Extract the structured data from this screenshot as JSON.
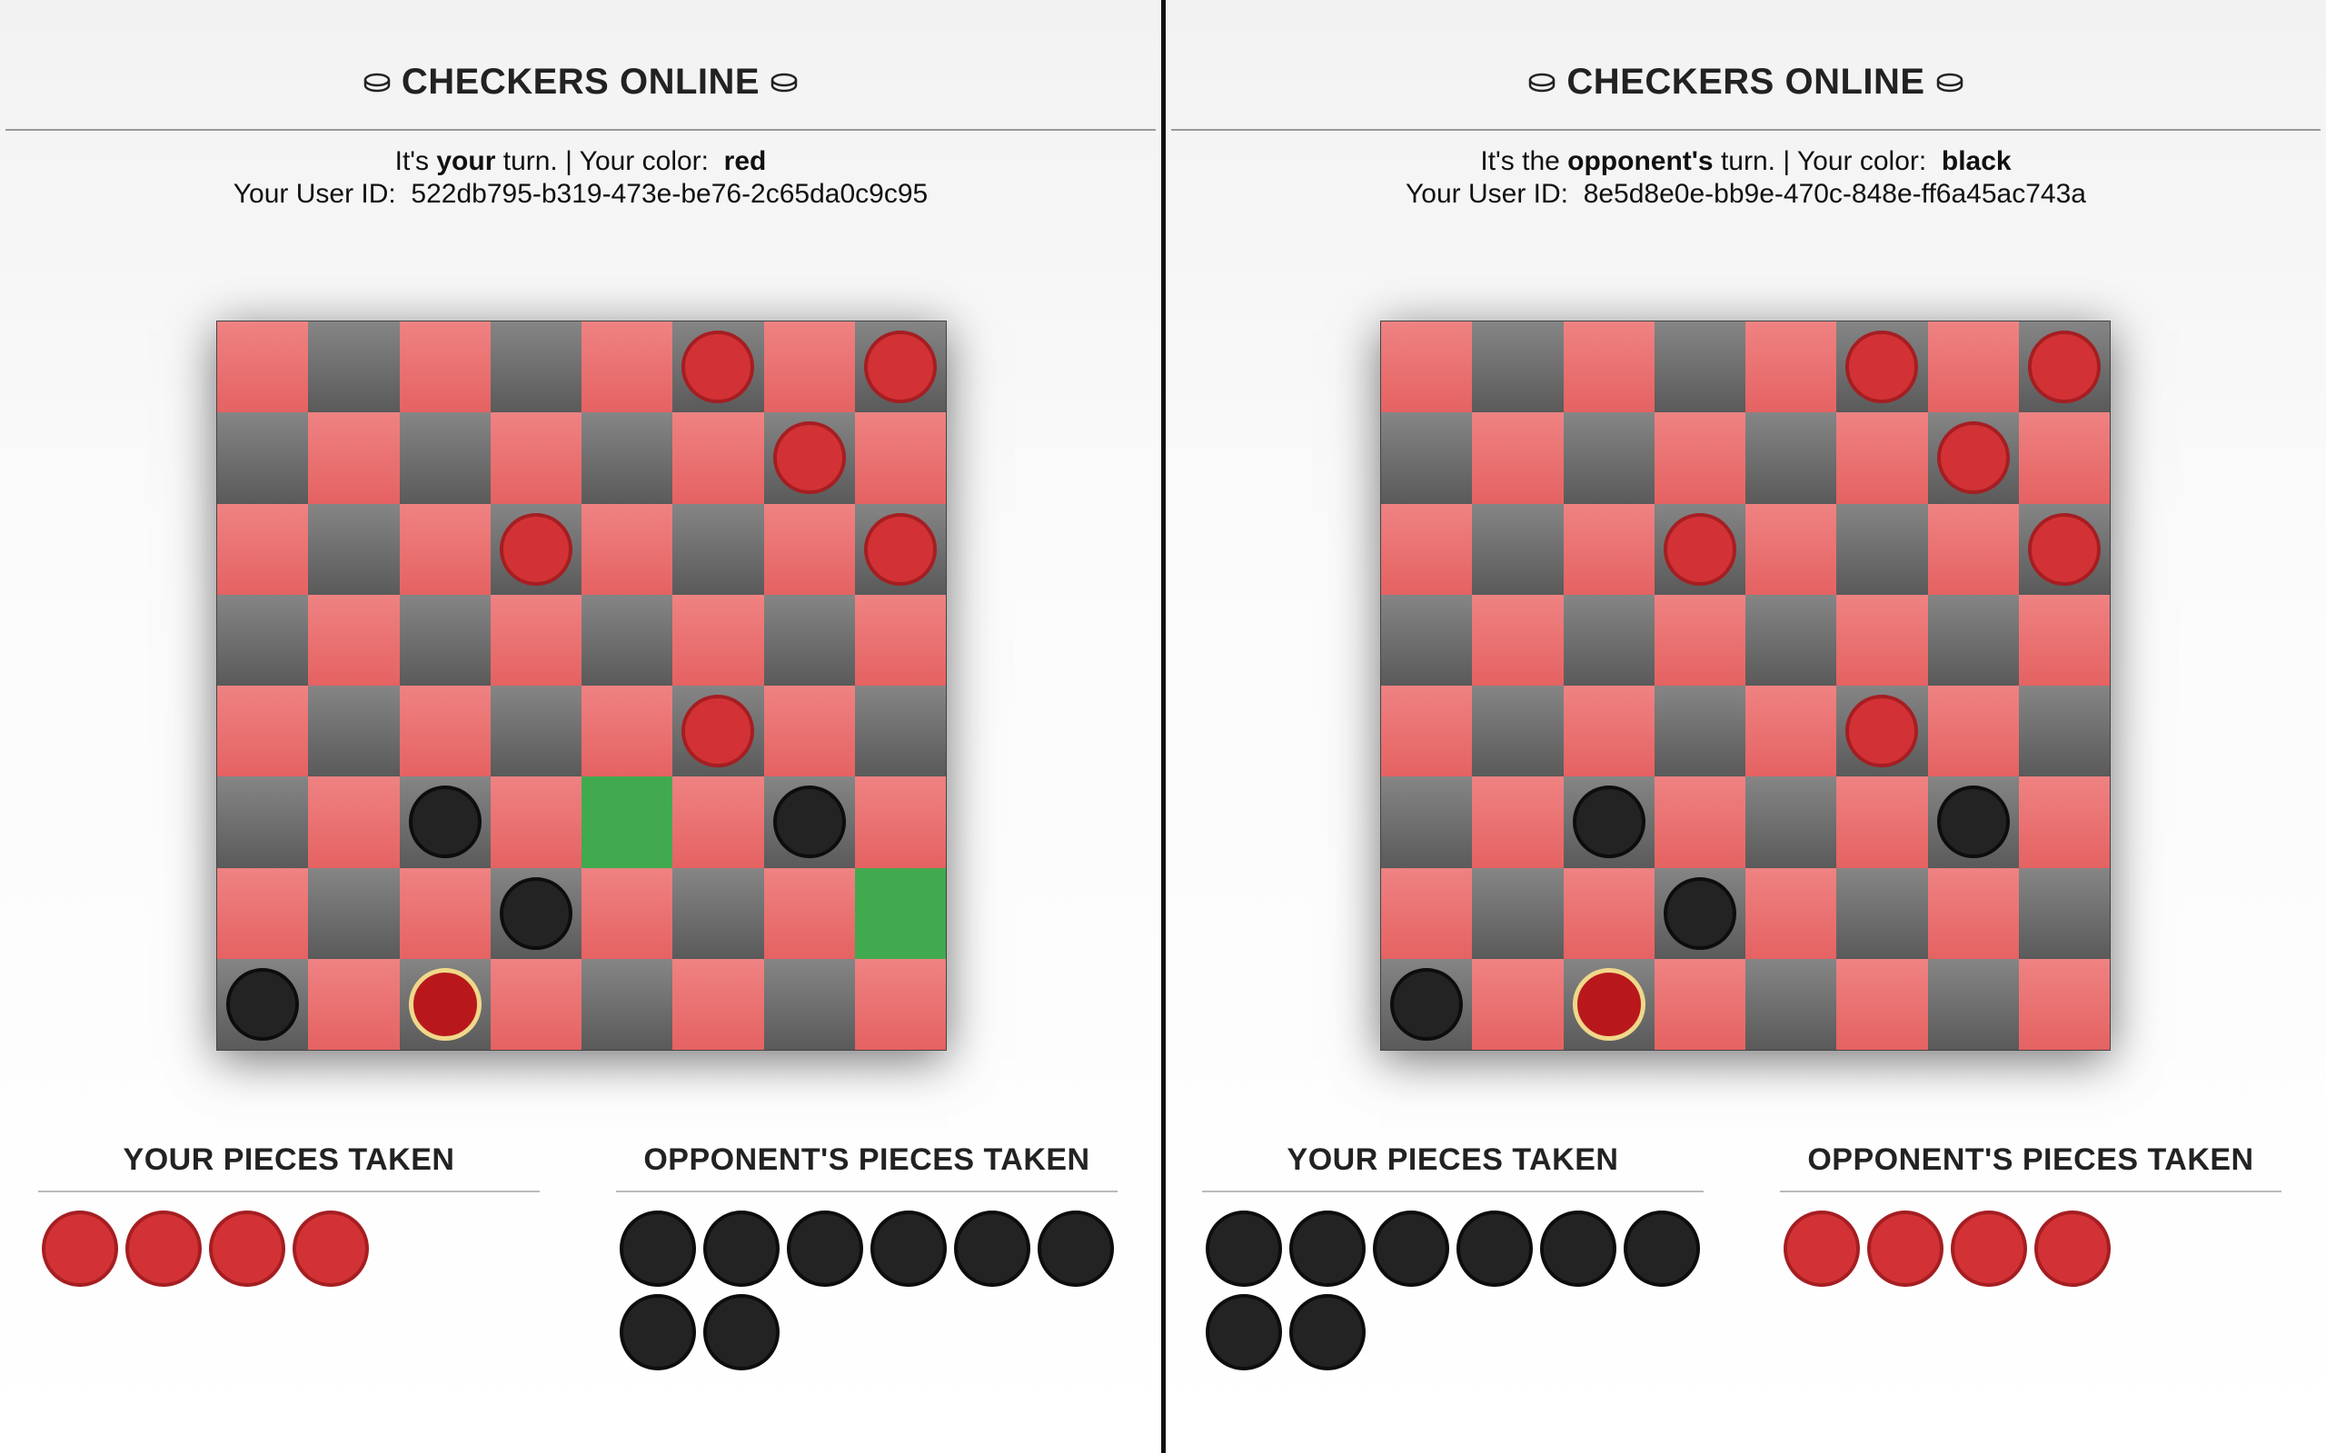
{
  "colors": {
    "light_square": "#e97070",
    "dark_square": "#707070",
    "highlight": "#41aa4f",
    "red_piece": "#d23235",
    "black_piece": "#232323",
    "selected_ring": "#f0d88a"
  },
  "panels": [
    {
      "title": "CHECKERS ONLINE",
      "title_icon": "checker-coin-icon",
      "turn_prefix": "It's",
      "turn_who": "your",
      "turn_suffix": "turn. | Your color:",
      "color_value": "red",
      "user_id_label": "Your User ID:",
      "user_id": "522db795-b319-473e-be76-2c65da0c9c95",
      "board": [
        [
          "",
          "",
          "",
          "",
          "",
          "r",
          "",
          "r"
        ],
        [
          "",
          "",
          "",
          "",
          "",
          "",
          "r",
          ""
        ],
        [
          "",
          "",
          "",
          "r",
          "",
          "",
          "",
          "r"
        ],
        [
          "",
          "",
          "",
          "",
          "",
          "",
          "",
          ""
        ],
        [
          "",
          "",
          "",
          "",
          "",
          "r",
          "",
          ""
        ],
        [
          "",
          "",
          "b",
          "",
          "",
          "",
          "b",
          ""
        ],
        [
          "",
          "",
          "",
          "b",
          "",
          "",
          "",
          ""
        ],
        [
          "b",
          "",
          "s",
          "",
          "",
          "",
          "",
          ""
        ]
      ],
      "highlighted": [
        [
          5,
          4
        ],
        [
          6,
          7
        ]
      ],
      "your_taken_label": "YOUR PIECES TAKEN",
      "your_taken": [
        "red",
        "red",
        "red",
        "red"
      ],
      "opp_taken_label": "OPPONENT'S PIECES TAKEN",
      "opp_taken": [
        "black",
        "black",
        "black",
        "black",
        "black",
        "black",
        "black",
        "black"
      ]
    },
    {
      "title": "CHECKERS ONLINE",
      "title_icon": "checker-coin-icon",
      "turn_prefix": "It's the",
      "turn_who": "opponent's",
      "turn_suffix": "turn. | Your color:",
      "color_value": "black",
      "user_id_label": "Your User ID:",
      "user_id": "8e5d8e0e-bb9e-470c-848e-ff6a45ac743a",
      "board": [
        [
          "",
          "",
          "",
          "",
          "",
          "r",
          "",
          "r"
        ],
        [
          "",
          "",
          "",
          "",
          "",
          "",
          "r",
          ""
        ],
        [
          "",
          "",
          "",
          "r",
          "",
          "",
          "",
          "r"
        ],
        [
          "",
          "",
          "",
          "",
          "",
          "",
          "",
          ""
        ],
        [
          "",
          "",
          "",
          "",
          "",
          "r",
          "",
          ""
        ],
        [
          "",
          "",
          "b",
          "",
          "",
          "",
          "b",
          ""
        ],
        [
          "",
          "",
          "",
          "b",
          "",
          "",
          "",
          ""
        ],
        [
          "b",
          "",
          "s",
          "",
          "",
          "",
          "",
          ""
        ]
      ],
      "highlighted": [],
      "your_taken_label": "YOUR PIECES TAKEN",
      "your_taken": [
        "black",
        "black",
        "black",
        "black",
        "black",
        "black",
        "black",
        "black"
      ],
      "opp_taken_label": "OPPONENT'S PIECES TAKEN",
      "opp_taken": [
        "red",
        "red",
        "red",
        "red"
      ]
    }
  ]
}
